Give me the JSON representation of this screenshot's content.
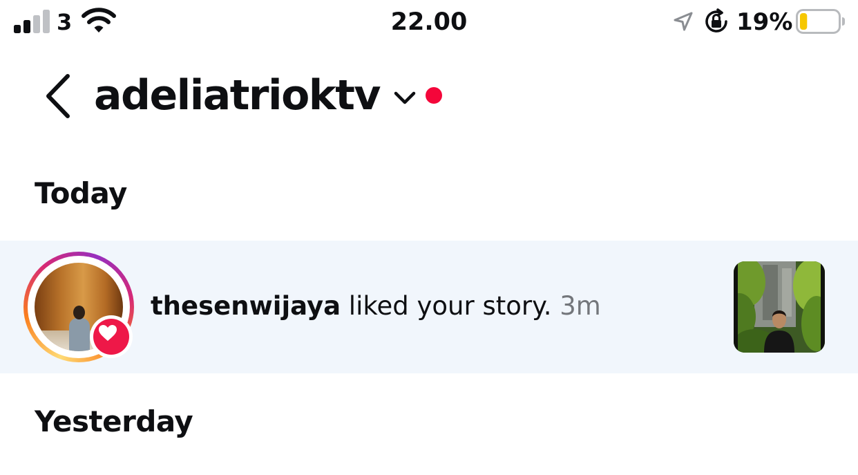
{
  "status_bar": {
    "carrier": "3",
    "time": "22.00",
    "battery_percent": "19%",
    "battery_level": 0.19,
    "signal_bars": 2,
    "icons": [
      "signal-icon",
      "wifi-icon",
      "location-icon",
      "rotation-lock-icon",
      "battery-icon"
    ]
  },
  "header": {
    "username": "adeliatrioktv",
    "icons": [
      "chevron-left-icon",
      "chevron-down-icon"
    ],
    "unread_dot_color": "#f4063a"
  },
  "sections": {
    "today": "Today",
    "yesterday": "Yesterday"
  },
  "notification": {
    "user": "thesenwijaya",
    "action": " liked your story.",
    "time": "3m",
    "badge_icon": "heart-icon",
    "badge_color": "#ee1848"
  },
  "colors": {
    "row_highlight": "#f1f6fc",
    "text_primary": "#0e0f12",
    "text_secondary": "#73767b"
  }
}
